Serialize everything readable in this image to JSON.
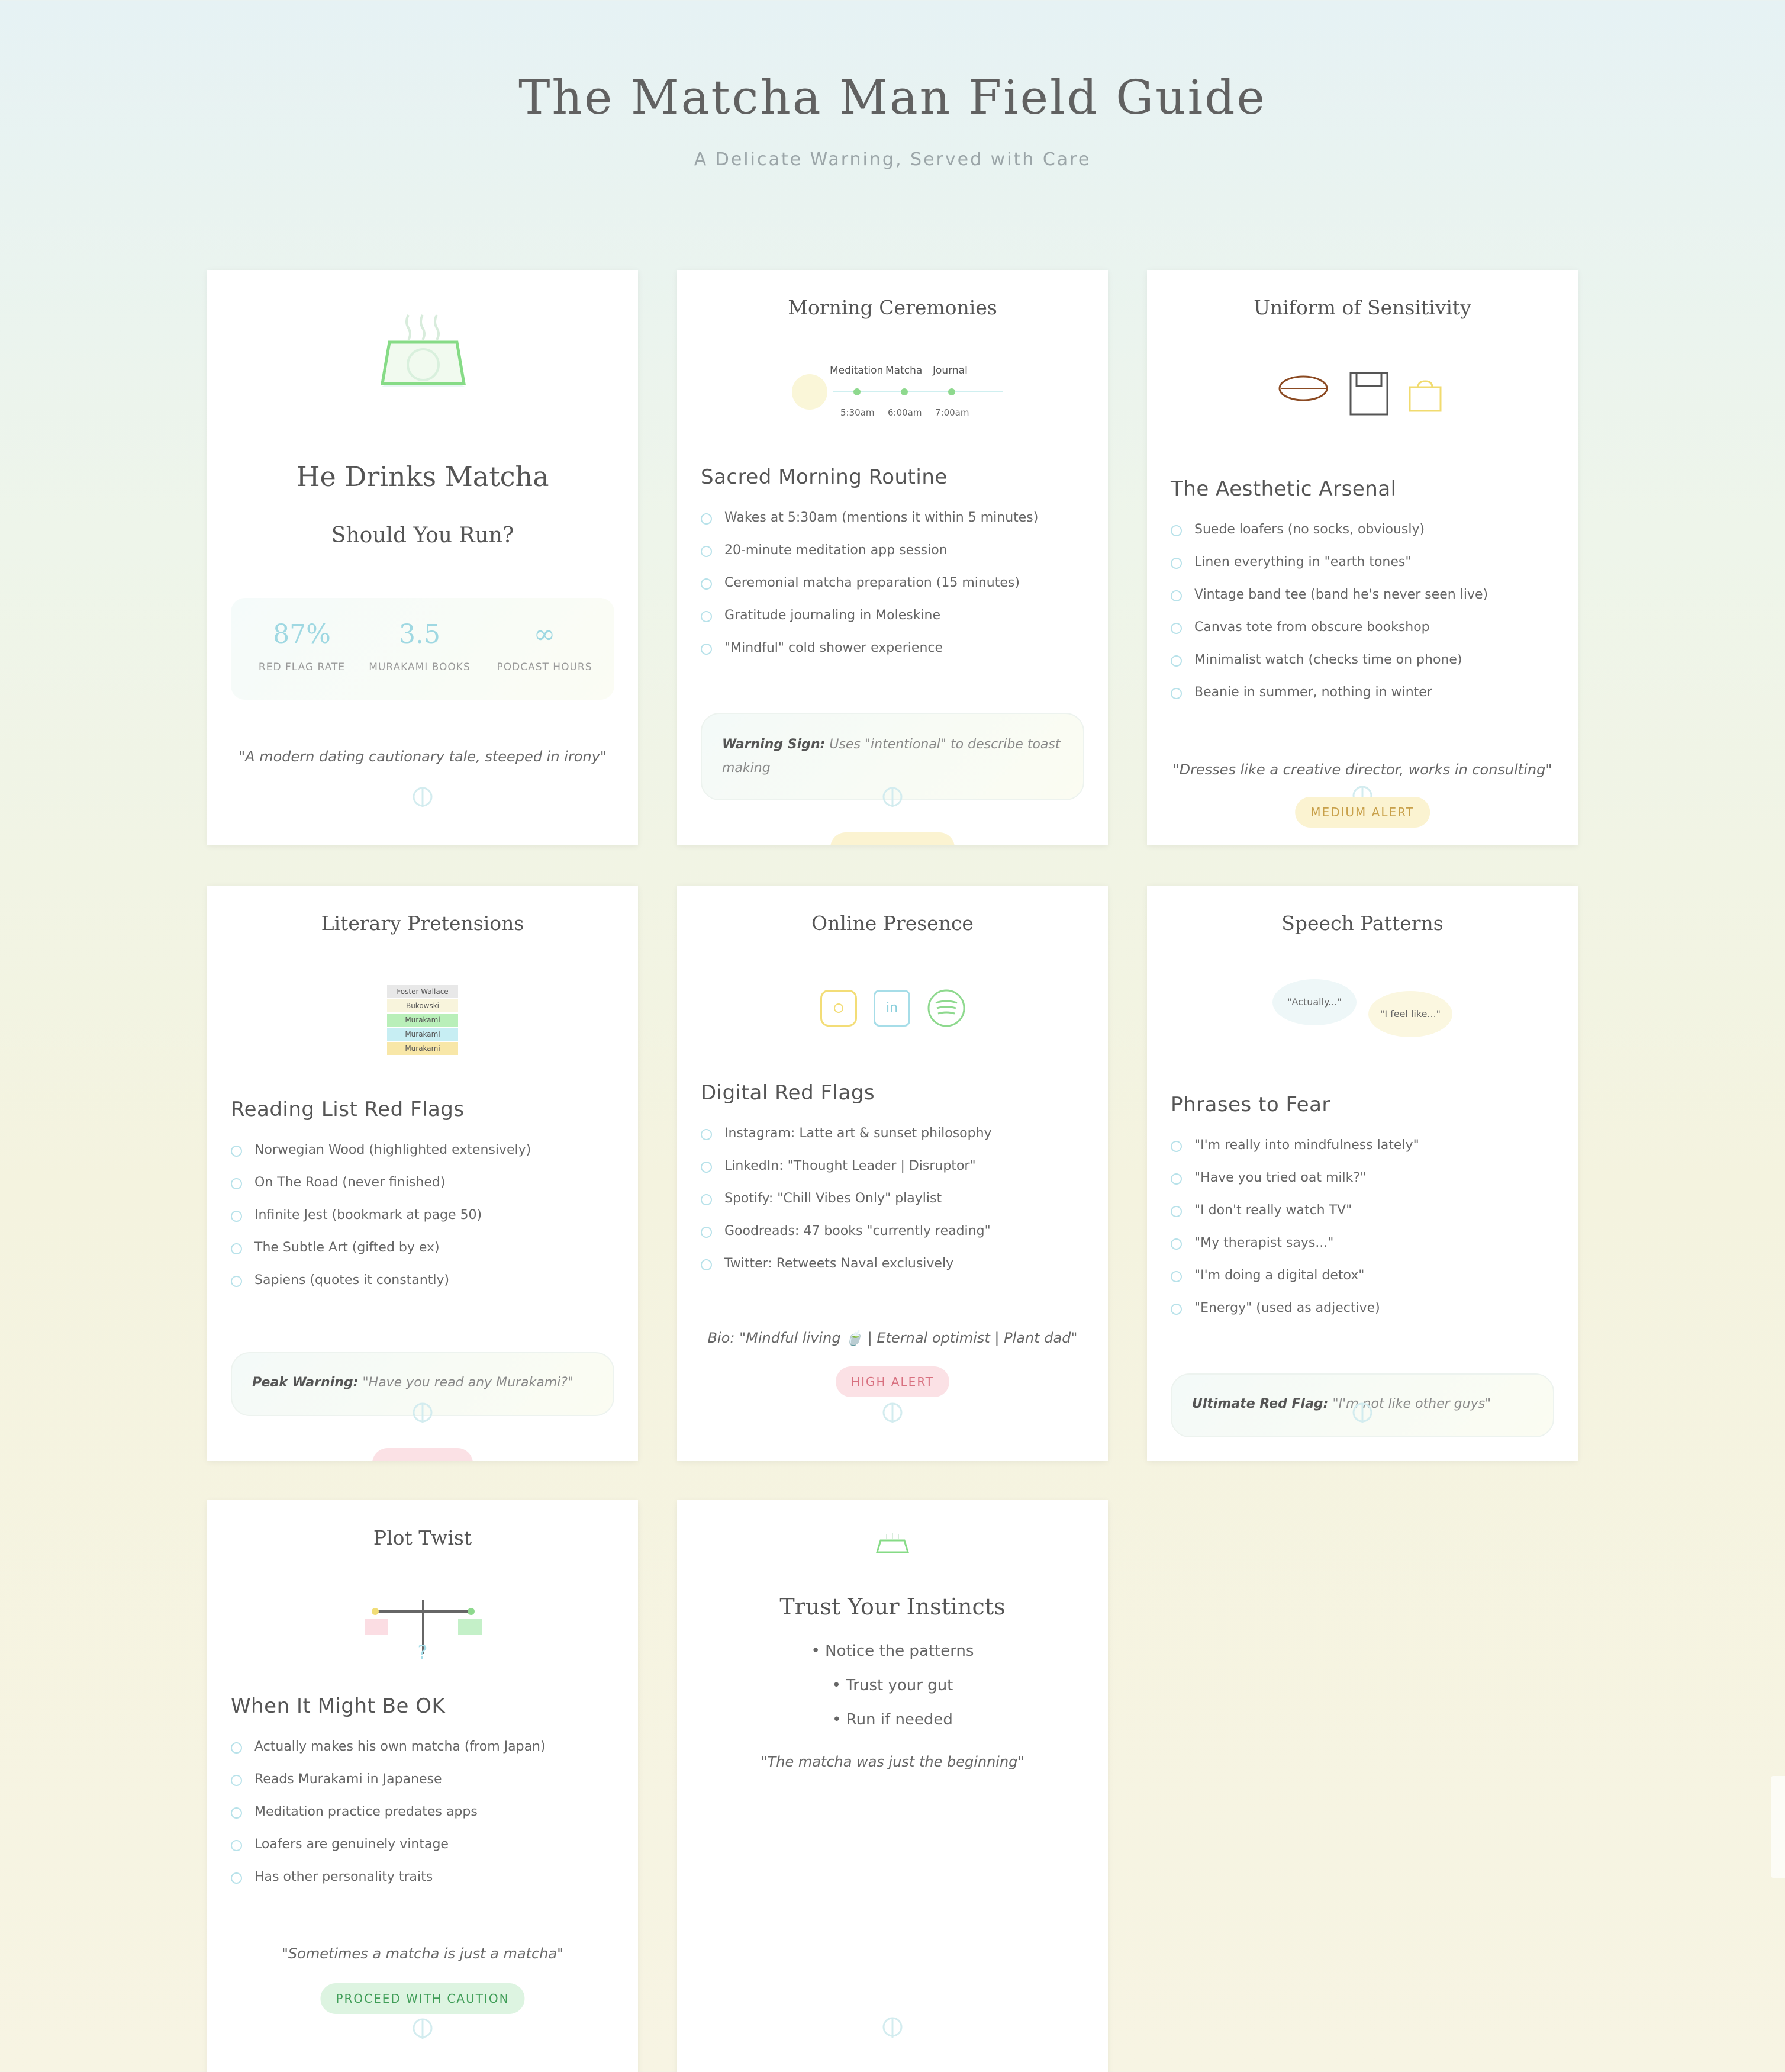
{
  "header": {
    "title": "The Matcha Man Field Guide",
    "subtitle": "A Delicate Warning, Served with Care"
  },
  "hero": {
    "title": "He Drinks Matcha",
    "subtitle": "Should You Run?",
    "stats": [
      {
        "value": "87%",
        "label": "RED FLAG RATE"
      },
      {
        "value": "3.5",
        "label": "MURAKAMI BOOKS"
      },
      {
        "value": "∞",
        "label": "PODCAST HOURS"
      }
    ],
    "quote": "\"A modern dating cautionary tale, steeped in irony\""
  },
  "morning": {
    "heading": "Morning Ceremonies",
    "timeline": {
      "labels": [
        "Meditation",
        "Matcha",
        "Journal"
      ],
      "times": [
        "5:30am",
        "6:00am",
        "7:00am"
      ]
    },
    "section_title": "Sacred Morning Routine",
    "items": [
      "Wakes at 5:30am (mentions it within 5 minutes)",
      "20-minute meditation app session",
      "Ceremonial matcha preparation (15 minutes)",
      "Gratitude journaling in Moleskine",
      "\"Mindful\" cold shower experience"
    ],
    "warning_label": "Warning Sign:",
    "warning_text": "Uses \"intentional\" to describe toast making"
  },
  "uniform": {
    "heading": "Uniform of Sensitivity",
    "section_title": "The Aesthetic Arsenal",
    "items": [
      "Suede loafers (no socks, obviously)",
      "Linen everything in \"earth tones\"",
      "Vintage band tee (band he's never seen live)",
      "Canvas tote from obscure bookshop",
      "Minimalist watch (checks time on phone)",
      "Beanie in summer, nothing in winter"
    ],
    "quote": "\"Dresses like a creative director, works in consulting\"",
    "badge": "MEDIUM ALERT"
  },
  "literary": {
    "heading": "Literary Pretensions",
    "books": [
      "Foster Wallace",
      "Bukowski",
      "Murakami",
      "Murakami",
      "Murakami"
    ],
    "section_title": "Reading List Red Flags",
    "items": [
      "Norwegian Wood (highlighted extensively)",
      "On The Road (never finished)",
      "Infinite Jest (bookmark at page 50)",
      "The Subtle Art (gifted by ex)",
      "Sapiens (quotes it constantly)"
    ],
    "warning_label": "Peak Warning:",
    "warning_text": "\"Have you read any Murakami?\""
  },
  "online": {
    "heading": "Online Presence",
    "icons": [
      "instagram-icon",
      "linkedin-icon",
      "spotify-icon"
    ],
    "linkedin_text": "in",
    "section_title": "Digital Red Flags",
    "items": [
      "Instagram: Latte art & sunset philosophy",
      "LinkedIn: \"Thought Leader | Disruptor\"",
      "Spotify: \"Chill Vibes Only\" playlist",
      "Goodreads: 47 books \"currently reading\"",
      "Twitter: Retweets Naval exclusively"
    ],
    "bio": "Bio: \"Mindful living 🍵 | Eternal optimist | Plant dad\"",
    "badge": "HIGH ALERT"
  },
  "speech": {
    "heading": "Speech Patterns",
    "bubbles": [
      "\"Actually...\"",
      "\"I feel like...\""
    ],
    "section_title": "Phrases to Fear",
    "items": [
      "\"I'm really into mindfulness lately\"",
      "\"Have you tried oat milk?\"",
      "\"I don't really watch TV\"",
      "\"My therapist says...\"",
      "\"I'm doing a digital detox\"",
      "\"Energy\" (used as adjective)"
    ],
    "warning_label": "Ultimate Red Flag:",
    "warning_text": "\"I'm not like other guys\""
  },
  "plot": {
    "heading": "Plot Twist",
    "scale_mark": "?",
    "section_title": "When It Might Be OK",
    "items": [
      "Actually makes his own matcha (from Japan)",
      "Reads Murakami in Japanese",
      "Meditation practice predates apps",
      "Loafers are genuinely vintage",
      "Has other personality traits"
    ],
    "quote": "\"Sometimes a matcha is just a matcha\"",
    "badge": "PROCEED WITH CAUTION"
  },
  "instincts": {
    "title": "Trust Your Instincts",
    "tips": [
      "• Notice the patterns",
      "• Trust your gut",
      "• Run if needed"
    ],
    "quote": "\"The matcha was just the beginning\""
  },
  "colors": {
    "accent_teal": "#9fd8e2",
    "accent_green": "#7ed27e",
    "alert_medium": "#c8a04a",
    "alert_high": "#d8707f",
    "alert_caution": "#3f9d57"
  }
}
